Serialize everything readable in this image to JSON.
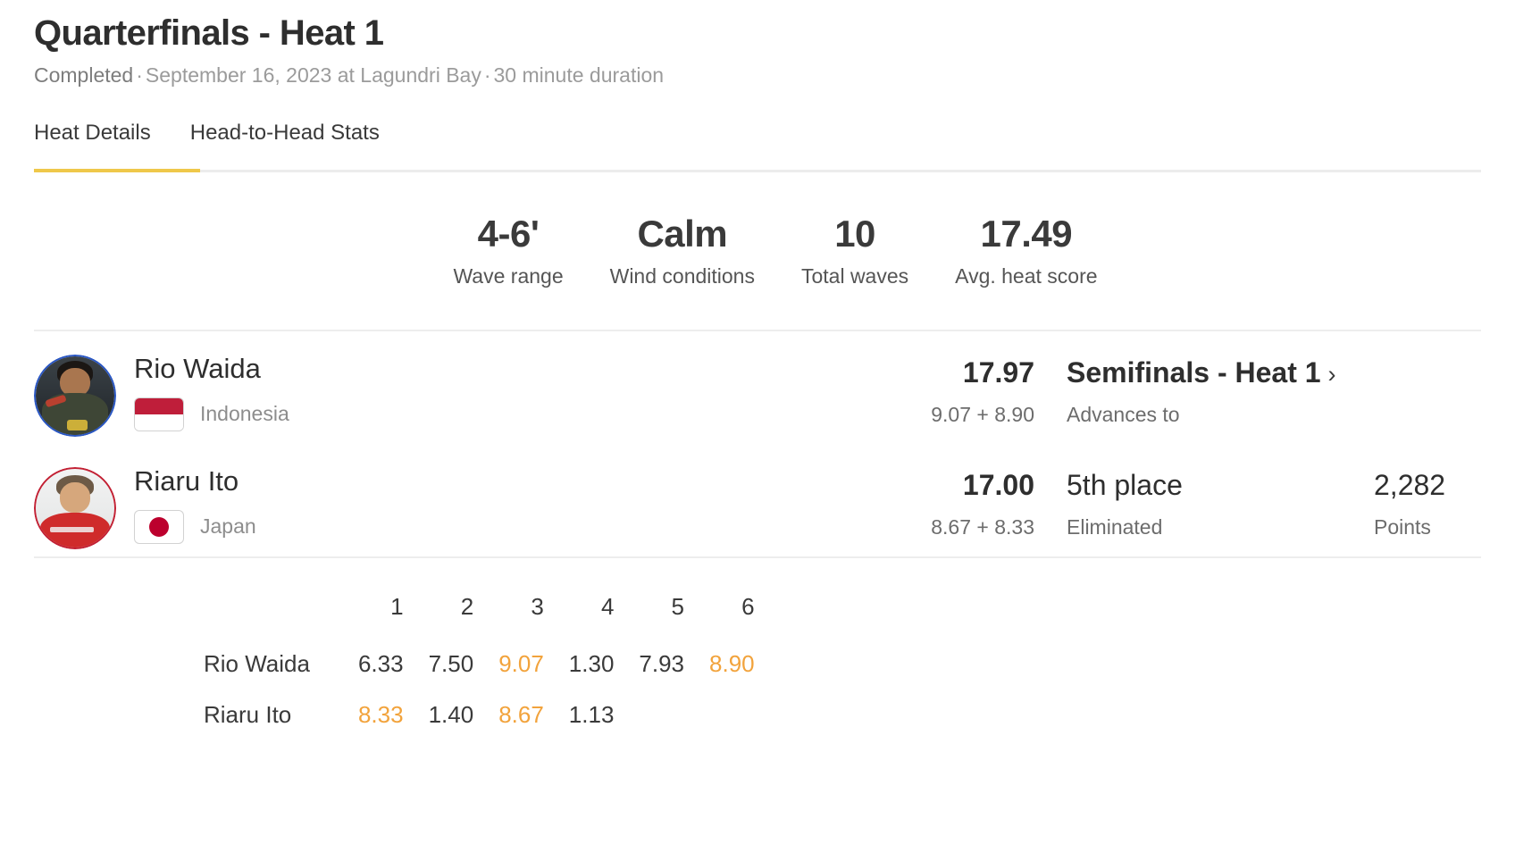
{
  "header": {
    "title": "Quarterfinals - Heat 1",
    "status": "Completed",
    "sep1": "·",
    "datetime": "September 16, 2023 at Lagundri Bay",
    "sep2": "·",
    "duration": "30 minute duration"
  },
  "tabs": [
    {
      "label": "Heat Details",
      "active": true
    },
    {
      "label": "Head-to-Head Stats",
      "active": false
    }
  ],
  "accent_color": "#efc84a",
  "stats": [
    {
      "value": "4-6'",
      "label": "Wave range"
    },
    {
      "value": "Calm",
      "label": "Wind conditions"
    },
    {
      "value": "10",
      "label": "Total waves"
    },
    {
      "value": "17.49",
      "label": "Avg. heat score"
    }
  ],
  "athletes": [
    {
      "name": "Rio Waida",
      "country": "Indonesia",
      "flag": "indonesia-flag",
      "ring_color": "#2a57c4",
      "score": "17.97",
      "wave_sum": "9.07 + 8.90",
      "status_title": "Semifinals - Heat 1",
      "status_chevron": "›",
      "status_sub": "Advances to",
      "points": "",
      "points_label": ""
    },
    {
      "name": "Riaru Ito",
      "country": "Japan",
      "flag": "japan-flag",
      "ring_color": "#c22033",
      "score": "17.00",
      "wave_sum": "8.67 + 8.33",
      "status_title": "5th place",
      "status_chevron": "",
      "status_sub": "Eliminated",
      "points": "2,282",
      "points_label": "Points"
    }
  ],
  "wave_table": {
    "corner": "",
    "columns": [
      "1",
      "2",
      "3",
      "4",
      "5",
      "6"
    ],
    "highlight_color": "#f2a33c",
    "rows": [
      {
        "name": "Rio Waida",
        "scores": [
          "6.33",
          "7.50",
          "9.07",
          "1.30",
          "7.93",
          "8.90"
        ],
        "best": [
          false,
          false,
          true,
          false,
          false,
          true
        ]
      },
      {
        "name": "Riaru Ito",
        "scores": [
          "8.33",
          "1.40",
          "8.67",
          "1.13",
          "",
          ""
        ],
        "best": [
          true,
          false,
          true,
          false,
          false,
          false
        ]
      }
    ]
  }
}
